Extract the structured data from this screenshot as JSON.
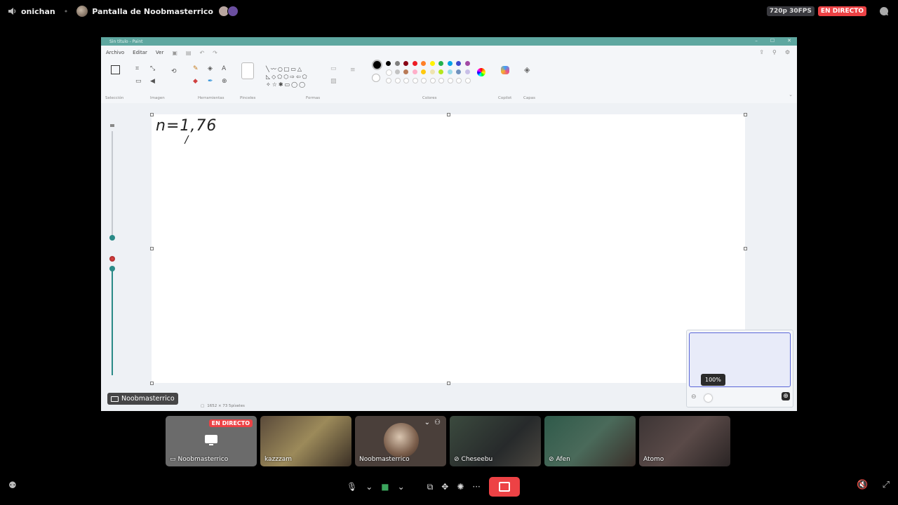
{
  "topbar": {
    "username": "onichan",
    "stream_title": "Pantalla de Noobmasterrico",
    "quality": "720p 30FPS",
    "live": "EN DIRECTO"
  },
  "paint": {
    "window_title": "Sin título - Paint",
    "menu": [
      "Archivo",
      "Editar",
      "Ver"
    ],
    "ribbon_groups": {
      "seleccion": "Selección",
      "imagen": "Imagen",
      "herramientas": "Herramientas",
      "pinceles": "Pinceles",
      "formas": "Formas",
      "colores": "Colores",
      "copilot": "Copilot",
      "capas": "Capas"
    },
    "palette_row1": [
      "#000000",
      "#7f7f7f",
      "#880015",
      "#ed1c24",
      "#ff7f27",
      "#fff200",
      "#22b14c",
      "#00a2e8",
      "#3f48cc",
      "#a349a4"
    ],
    "palette_row2": [
      "#ffffff",
      "#c3c3c3",
      "#b97a57",
      "#ffaec9",
      "#ffc90e",
      "#efe4b0",
      "#b5e61d",
      "#99d9ea",
      "#7092be",
      "#c8bfe7"
    ],
    "canvas_text": "n=1,76",
    "status_size": "1652 × 73 5píxeles",
    "zoom": "100%"
  },
  "stream_owner_tag": "Noobmasterrico",
  "tiles": [
    {
      "name": "Noobmasterrico",
      "live": "EN DIRECTO"
    },
    {
      "name": "kazzzam"
    },
    {
      "name": "Noobmasterrico"
    },
    {
      "name": "Cheseebu"
    },
    {
      "name": "Afen"
    },
    {
      "name": "Atomo"
    }
  ]
}
